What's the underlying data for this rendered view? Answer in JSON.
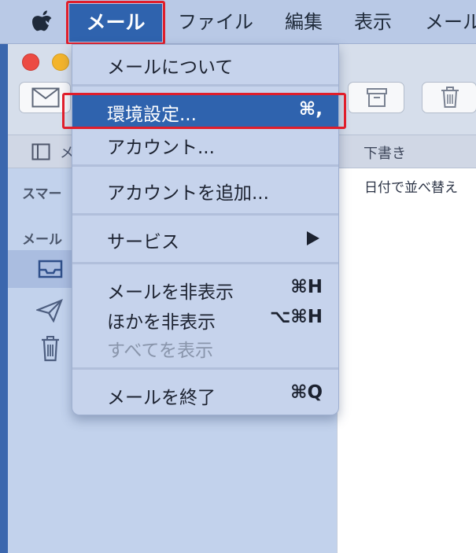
{
  "menubar": {
    "items": [
      {
        "label": "メール"
      },
      {
        "label": "ファイル"
      },
      {
        "label": "編集"
      },
      {
        "label": "表示"
      },
      {
        "label": "メール"
      }
    ]
  },
  "window": {
    "toolbar": {
      "sidebar_label": "メ",
      "drafts_label": "下書き"
    },
    "sidebar": {
      "smart_heading": "スマー",
      "mail_heading": "メール"
    },
    "list": {
      "sort_label": "日付で並べ替え"
    }
  },
  "dropdown": {
    "items": [
      {
        "label": "メールについて",
        "shortcut": ""
      },
      {
        "label": "環境設定...",
        "shortcut": "⌘,"
      },
      {
        "label": "アカウント...",
        "shortcut": ""
      },
      {
        "label": "アカウントを追加...",
        "shortcut": ""
      },
      {
        "label": "サービス",
        "shortcut": ""
      },
      {
        "label": "メールを非表示",
        "shortcut": "⌘H"
      },
      {
        "label": "ほかを非表示",
        "shortcut": "⌥⌘H"
      },
      {
        "label": "すべてを表示",
        "shortcut": ""
      },
      {
        "label": "メールを終了",
        "shortcut": "⌘Q"
      }
    ]
  },
  "colors": {
    "highlight_box": "#e01e2b",
    "selection": "#2f63ae"
  }
}
